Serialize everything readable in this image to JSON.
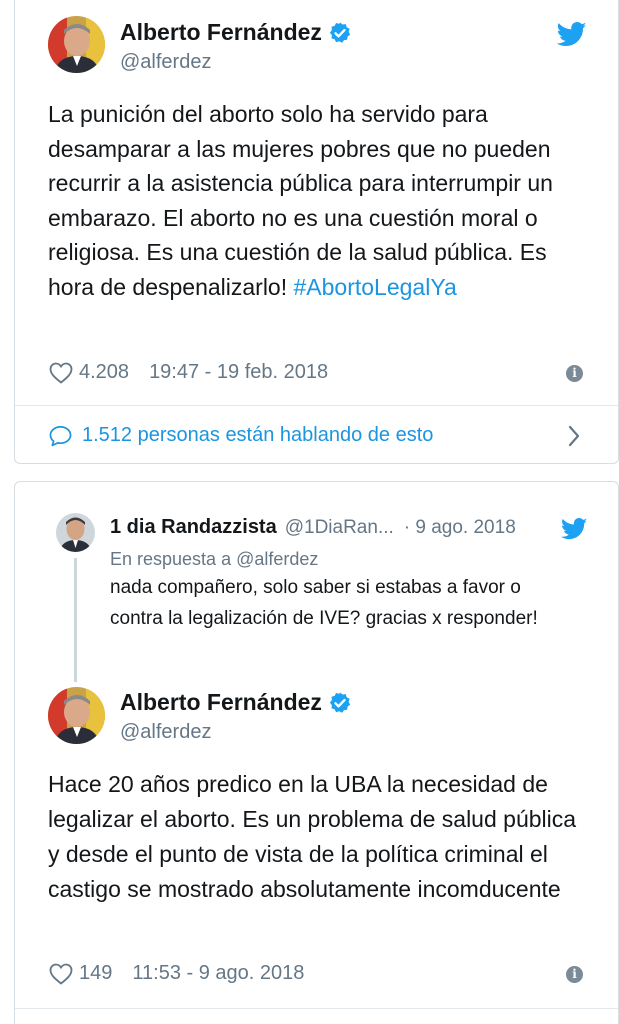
{
  "tweet1": {
    "author_name": "Alberto Fernández",
    "author_handle": "@alferdez",
    "text": "La punición del aborto solo ha servido para desamparar a las mujeres pobres que no pueden recurrir a la asistencia pública para interrumpir un embarazo. El aborto no es una cuestión moral o religiosa. Es una cuestión de la salud pública. Es hora de despenalizarlo!",
    "hashtag": "#AbortoLegalYa",
    "likes": "4.208",
    "timestamp": "19:47 - 19 feb. 2018",
    "conversation_text": "1.512 personas están hablando de esto"
  },
  "reply": {
    "author_name": "1 dia Randazzista",
    "author_handle": "@1DiaRan...",
    "date": "· 9 ago. 2018",
    "in_reply_to": "En respuesta a @alferdez",
    "text": "nada compañero, solo saber si estabas a favor o contra la legalización de IVE? gracias x responder!"
  },
  "tweet2": {
    "author_name": "Alberto Fernández",
    "author_handle": "@alferdez",
    "text": "Hace 20 años predico en la UBA la necesidad de legalizar el aborto. Es un problema de salud pública y desde el punto de vista de la política criminal el castigo se mostrado absolutamente incomducente",
    "likes": "149",
    "timestamp": "11:53 - 9 ago. 2018"
  },
  "colors": {
    "twitter_blue": "#1da1f2",
    "link_blue": "#1b95e0",
    "text": "#14171a",
    "secondary": "#657786",
    "border": "#d6dde3"
  },
  "icons": [
    "twitter-bird-icon",
    "verified-badge-icon",
    "heart-icon",
    "info-icon",
    "speech-bubble-icon",
    "chevron-right-icon"
  ]
}
